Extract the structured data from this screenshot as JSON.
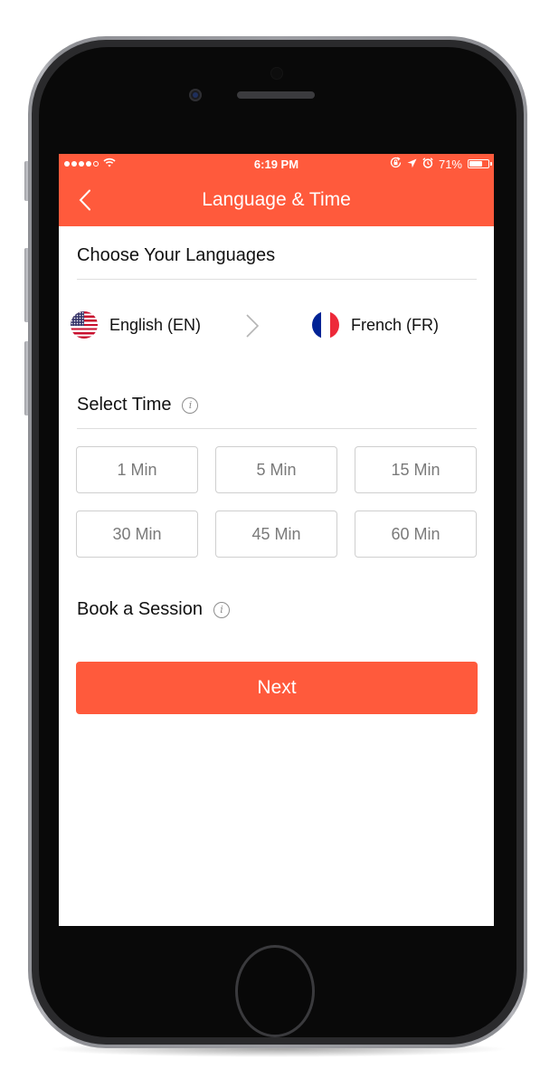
{
  "status_bar": {
    "signal_bars_filled": 4,
    "signal_bars_total": 5,
    "wifi_icon": "wifi-icon",
    "time": "6:19 PM",
    "orientation_lock_icon": "orientation-lock-icon",
    "location_icon": "location-arrow-icon",
    "alarm_icon": "alarm-clock-icon",
    "battery_percent_label": "71%",
    "battery_level": 0.71
  },
  "nav": {
    "back_icon": "chevron-left-icon",
    "title": "Language & Time"
  },
  "languages": {
    "section_title": "Choose Your Languages",
    "source": {
      "label": "English (EN)",
      "flag": "us-flag-icon"
    },
    "swap_icon": "chevron-right-icon",
    "target": {
      "label": "French (FR)",
      "flag": "france-flag-icon"
    }
  },
  "time": {
    "section_title": "Select Time",
    "info_icon": "info-icon",
    "options": [
      "1 Min",
      "5 Min",
      "15 Min",
      "30 Min",
      "45 Min",
      "60 Min"
    ]
  },
  "session": {
    "section_title": "Book a Session",
    "info_icon": "info-icon"
  },
  "actions": {
    "next_label": "Next"
  },
  "colors": {
    "accent": "#ff5a3c",
    "option_border": "#cfcfcf",
    "option_text": "#7a7a7a"
  }
}
